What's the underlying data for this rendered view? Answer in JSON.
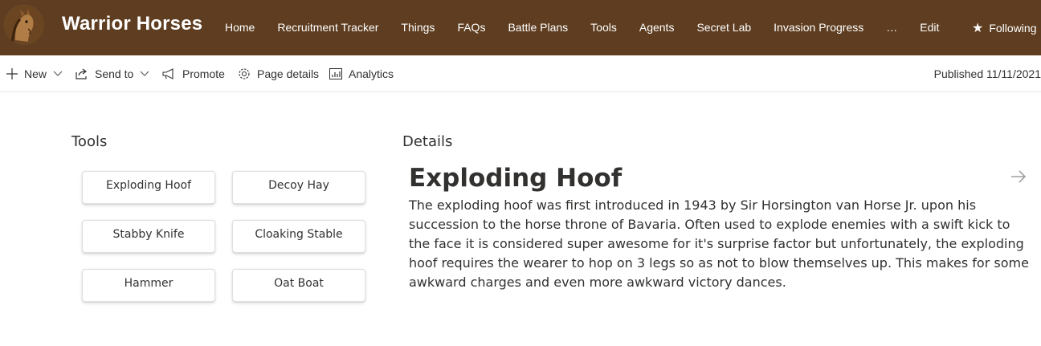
{
  "header": {
    "site_title": "Warrior Horses",
    "logo_icon": "horse-logo-icon",
    "background": "#5e3d20",
    "nav": [
      "Home",
      "Recruitment Tracker",
      "Things",
      "FAQs",
      "Battle Plans",
      "Tools",
      "Agents",
      "Secret Lab",
      "Invasion Progress",
      "…",
      "Edit"
    ],
    "follow_label": "Following"
  },
  "commandbar": {
    "new_label": "New",
    "sendto_label": "Send to",
    "promote_label": "Promote",
    "page_details_label": "Page details",
    "analytics_label": "Analytics",
    "published": "Published 11/11/2021"
  },
  "tools": {
    "title": "Tools",
    "buttons": [
      "Exploding Hoof",
      "Decoy Hay",
      "Stabby Knife",
      "Cloaking Stable",
      "Hammer",
      "Oat Boat"
    ]
  },
  "details": {
    "title": "Details",
    "heading": "Exploding Hoof",
    "body": "The exploding hoof was first introduced in 1943 by Sir Horsington van Horse Jr. upon his succession to the horse throne of Bavaria. Often used to explode enemies with a swift kick to the face it is considered super awesome for it's surprise factor but unfortunately, the exploding hoof requires the wearer to hop on 3 legs so as not to blow themselves up. This makes for some awkward charges and even more awkward victory dances."
  }
}
